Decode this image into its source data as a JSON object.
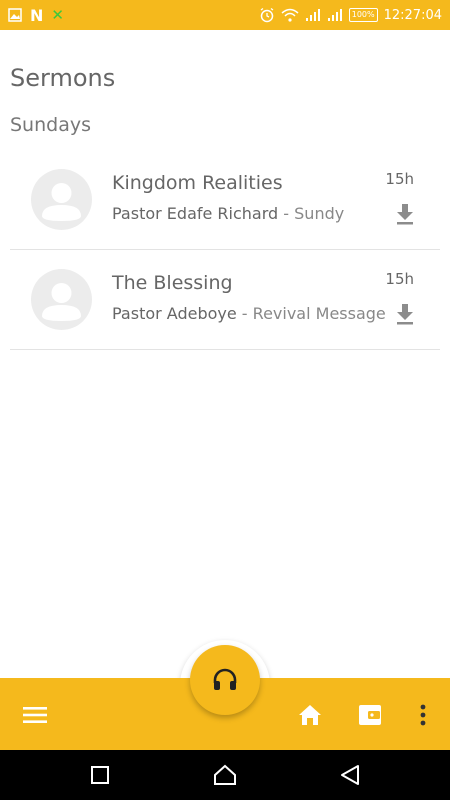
{
  "status_bar": {
    "left_icons": [
      "image-icon",
      "n-icon",
      "close-x-icon"
    ],
    "n_label": "N",
    "x_label": "✕",
    "battery": "100%",
    "time": "12:27:04",
    "accent_color": "#f5b91c"
  },
  "page": {
    "title": "Sermons",
    "section": "Sundays"
  },
  "sermons": [
    {
      "title": "Kingdom Realities",
      "pastor": "Pastor Edafe Richard",
      "separator": " - ",
      "category": "Sundy",
      "time": "15h"
    },
    {
      "title": "The Blessing",
      "pastor": "Pastor Adeboye",
      "separator": " - ",
      "category": "Revival Message",
      "time": "15h"
    }
  ],
  "bottom_bar": {
    "icons": [
      "menu-icon",
      "headphones-icon",
      "home-icon",
      "wallet-icon",
      "more-vertical-icon"
    ]
  },
  "android_nav": {
    "icons": [
      "recents-square-icon",
      "home-circle-icon",
      "back-triangle-icon"
    ]
  }
}
